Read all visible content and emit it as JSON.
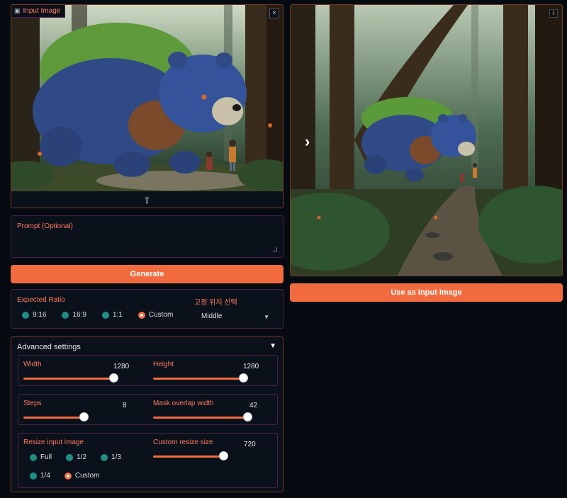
{
  "input_image": {
    "label": "Input Image",
    "upload_icon": "upload-icon",
    "close_icon": "close-icon"
  },
  "output_image": {
    "download_icon": "download-icon",
    "nav_icon": "chevron-right-icon"
  },
  "prompt": {
    "label": "Prompt (Optional)",
    "value": ""
  },
  "generate_label": "Generate",
  "use_input_label": "Use as Input Image",
  "ratio": {
    "label": "Expected Ratio",
    "options": [
      "9:16",
      "16:9",
      "1:1",
      "Custom"
    ],
    "selected": "Custom",
    "position_label": "고정 위치 선택",
    "position_value": "Middle"
  },
  "advanced": {
    "title": "Advanced settings",
    "width": {
      "label": "Width",
      "value": "1280",
      "fraction": 0.98
    },
    "height": {
      "label": "Height",
      "value": "1280",
      "fraction": 0.98
    },
    "steps": {
      "label": "Steps",
      "value": "8",
      "fraction": 0.55
    },
    "mask_overlap": {
      "label": "Mask overlap width",
      "value": "42",
      "fraction": 0.98
    },
    "resize_input": {
      "label": "Resize input image",
      "options": [
        "Full",
        "1/2",
        "1/3",
        "1/4",
        "Custom"
      ],
      "selected": "Custom"
    },
    "custom_resize": {
      "label": "Custom resize size",
      "value": "720",
      "fraction": 0.68
    }
  },
  "colors": {
    "accent": "#f26b3f",
    "teal": "#1d8f83",
    "border": "#7a3a20"
  }
}
